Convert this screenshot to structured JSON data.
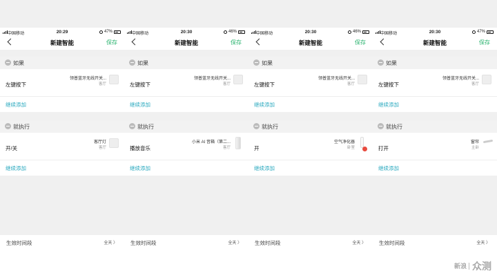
{
  "phones": [
    {
      "time": "20:29",
      "carrier": "中国移动",
      "battery": "47%",
      "battery_level": 0.47,
      "title": "新建智能",
      "save": "保存",
      "if_header": "如果",
      "if_action": "左键按下",
      "if_device": "领普蓝牙无线开关...",
      "if_room": "客厅",
      "then_header": "就执行",
      "then_action": "开/关",
      "then_device": "客厅灯",
      "then_room": "客厅",
      "then_thumb": "plain",
      "add_label": "继续添加",
      "period_label": "生效时间段",
      "period_value": "全天"
    },
    {
      "time": "20:30",
      "carrier": "中国移动",
      "battery": "46%",
      "battery_level": 0.46,
      "title": "新建智能",
      "save": "保存",
      "if_header": "如果",
      "if_action": "左键按下",
      "if_device": "领普蓝牙无线开关...",
      "if_room": "客厅",
      "then_header": "就执行",
      "then_action": "播放音乐",
      "then_device": "小米 AI 音箱（第二...",
      "then_room": "客厅",
      "then_thumb": "speaker",
      "add_label": "继续添加",
      "period_label": "生效时间段",
      "period_value": "全天"
    },
    {
      "time": "20:30",
      "carrier": "中国移动",
      "battery": "46%",
      "battery_level": 0.46,
      "title": "新建智能",
      "save": "保存",
      "if_header": "如果",
      "if_action": "左键按下",
      "if_device": "领普蓝牙无线开关...",
      "if_room": "客厅",
      "then_header": "就执行",
      "then_action": "开",
      "then_device": "空气净化器",
      "then_room": "卧室",
      "then_thumb": "purifier",
      "add_label": "继续添加",
      "period_label": "生效时间段",
      "period_value": "全天"
    },
    {
      "time": "20:30",
      "carrier": "中国移动",
      "battery": "47%",
      "battery_level": 0.47,
      "title": "新建智能",
      "save": "保存",
      "if_header": "如果",
      "if_action": "左键按下",
      "if_device": "领普蓝牙无线开关...",
      "if_room": "客厅",
      "then_header": "就执行",
      "then_action": "打开",
      "then_device": "窗帘",
      "then_room": "主卧",
      "then_thumb": "curtain",
      "add_label": "继续添加",
      "period_label": "生效时间段",
      "period_value": "全天"
    }
  ],
  "watermark": {
    "logo": "新浪",
    "text": "众测"
  },
  "colors": {
    "accent_green": "#29b36e",
    "link_blue": "#2aa9bf",
    "badge_red": "#e84a3e"
  }
}
